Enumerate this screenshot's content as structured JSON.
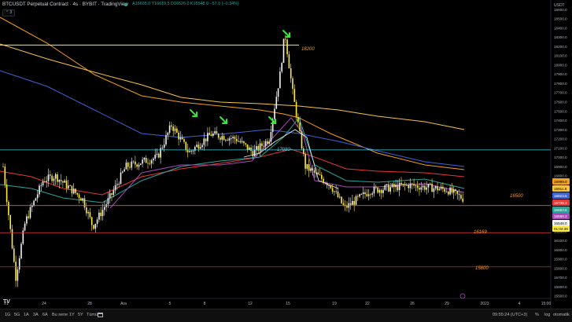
{
  "header": {
    "symbol": "BTCUSDT Perpetual Contract · 4s · BYBIT · TradingView",
    "ohlc": "A16605.0 Y16619.5 D16526.0 K16548.0 −57.0 (−0.34%)",
    "collapse": "⌃ 3"
  },
  "price_axis": {
    "currency": "USDT",
    "ticks": [
      "18600.0",
      "18500.0",
      "18400.0",
      "18300.0",
      "18200.0",
      "18100.0",
      "18000.0",
      "17900.0",
      "17800.0",
      "17700.0",
      "17600.0",
      "17500.0",
      "17400.0",
      "17300.0",
      "17200.0",
      "17100.0",
      "17000.0",
      "16900.0",
      "16800.0",
      "16700.0",
      "16600.0",
      "16500.0",
      "16400.0",
      "16300.0",
      "16200.0",
      "16100.0",
      "16000.0",
      "15900.0",
      "15800.0",
      "15700.0",
      "15600.0",
      "15500.0"
    ],
    "tags": [
      {
        "label": "16999.0",
        "color": "#f59d1c"
      },
      {
        "label": "16911.8",
        "color": "#f6c343"
      },
      {
        "label": "16823.5",
        "color": "#3f63d6"
      },
      {
        "label": "16736.3",
        "color": "#e53935"
      },
      {
        "label": "16653.5",
        "color": "#26a69a"
      },
      {
        "label": "16598.3",
        "color": "#ab47bc"
      },
      {
        "label": "16548.0",
        "color": "#f5f5f5"
      },
      {
        "label": "01:04:36",
        "color": "#ffeb3b"
      }
    ]
  },
  "levels": [
    {
      "label": "18200",
      "price": 18215,
      "color": "#ffeb3b"
    },
    {
      "label": "17080",
      "price": 17080,
      "color": "#4dd0e1"
    },
    {
      "label": "16500",
      "price": 16478,
      "color": "#e57373"
    },
    {
      "label": "16169",
      "price": 16185,
      "color": "#e53935"
    },
    {
      "label": "15800",
      "price": 15815,
      "color": "#e53935"
    }
  ],
  "time_axis": {
    "ticks": [
      "21",
      "24",
      "28",
      "Ara",
      "5",
      "8",
      "12",
      "15",
      "19",
      "22",
      "26",
      "29",
      "2023",
      "4",
      "15:00"
    ]
  },
  "bottom_bar": {
    "timeframes": [
      "1G",
      "5G",
      "1A",
      "3A",
      "6A",
      "Bu sene",
      "1Y",
      "5Y",
      "Tümü"
    ],
    "clock": "09:55:24 (UTC+3)",
    "percent": "%",
    "log": "log",
    "auto": "otomatik"
  },
  "tv_logo": "TV",
  "chart_data": {
    "type": "candlestick",
    "series": [
      {
        "name": "price",
        "x": [
          "21",
          "24",
          "28",
          "Ara",
          "5",
          "8",
          "12",
          "15",
          "19",
          "22",
          "26",
          "29"
        ],
        "values": [
          15550,
          16200,
          16000,
          16550,
          17300,
          17250,
          17150,
          18370,
          16450,
          16600,
          16700,
          16548
        ]
      }
    ],
    "ylim": [
      15500,
      18650
    ],
    "markers": [
      "down-arrow",
      "down-arrow",
      "down-arrow",
      "down-arrow"
    ]
  }
}
